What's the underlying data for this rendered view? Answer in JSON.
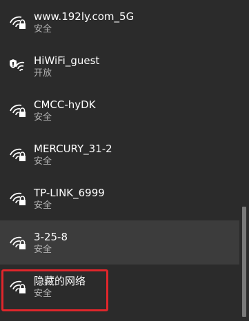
{
  "networks": [
    {
      "name": "www.192ly.com_5G",
      "status": "安全",
      "icon": "wifi-secure-icon"
    },
    {
      "name": "HiWiFi_guest",
      "status": "开放",
      "icon": "wifi-open-shield-icon"
    },
    {
      "name": "CMCC-hyDK",
      "status": "安全",
      "icon": "wifi-secure-icon"
    },
    {
      "name": "MERCURY_31-2",
      "status": "安全",
      "icon": "wifi-secure-icon"
    },
    {
      "name": "TP-LINK_6999",
      "status": "安全",
      "icon": "wifi-secure-icon"
    },
    {
      "name": "3-25-8",
      "status": "安全",
      "icon": "wifi-secure-icon"
    },
    {
      "name": "隐藏的网络",
      "status": "安全",
      "icon": "wifi-secure-icon"
    }
  ],
  "colors": {
    "panel_background": "#2b2b2b",
    "hover_background": "#3c3c3c",
    "highlight_border": "#e0262b",
    "scrollbar_thumb": "#7a7a7a"
  }
}
